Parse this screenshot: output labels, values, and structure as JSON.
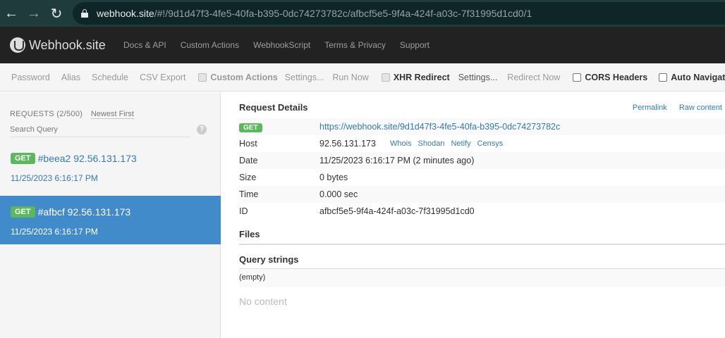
{
  "browser": {
    "url_host": "webhook.site",
    "url_path": "/#!/9d1d47f3-4fe5-40fa-b395-0dc74273782c/afbcf5e5-9f4a-424f-a03c-7f31995d1cd0/1"
  },
  "navbar": {
    "brand": "Webhook.site",
    "links": [
      "Docs & API",
      "Custom Actions",
      "WebhookScript",
      "Terms & Privacy",
      "Support"
    ]
  },
  "toolbar": {
    "password": "Password",
    "alias": "Alias",
    "schedule": "Schedule",
    "csv_export": "CSV Export",
    "custom_actions": "Custom Actions",
    "custom_settings": "Settings...",
    "run_now": "Run Now",
    "xhr_redirect": "XHR Redirect",
    "xhr_settings": "Settings...",
    "redirect_now": "Redirect Now",
    "cors_headers": "CORS Headers",
    "auto_navigate": "Auto Navigate"
  },
  "sidebar": {
    "requests_count": "REQUESTS (2/500)",
    "sort": "Newest First",
    "search_placeholder": "Search Query",
    "help": "?",
    "items": [
      {
        "method": "GET",
        "title": "#beea2 92.56.131.173",
        "time": "11/25/2023 6:16:17 PM",
        "selected": false
      },
      {
        "method": "GET",
        "title": "#afbcf 92.56.131.173",
        "time": "11/25/2023 6:16:17 PM",
        "selected": true
      }
    ]
  },
  "details": {
    "title": "Request Details",
    "permalink": "Permalink",
    "raw_content": "Raw content",
    "method": "GET",
    "url": "https://webhook.site/9d1d47f3-4fe5-40fa-b395-0dc74273782c",
    "rows": {
      "host_label": "Host",
      "host": "92.56.131.173",
      "date_label": "Date",
      "date": "11/25/2023 6:16:17 PM (2 minutes ago)",
      "size_label": "Size",
      "size": "0 bytes",
      "time_label": "Time",
      "time": "0.000 sec",
      "id_label": "ID",
      "id": "afbcf5e5-9f4a-424f-a03c-7f31995d1cd0"
    },
    "lookups": [
      "Whois",
      "Shodan",
      "Netify",
      "Censys"
    ]
  },
  "files": {
    "title": "Files"
  },
  "query_strings": {
    "title": "Query strings",
    "empty": "(empty)"
  },
  "content": {
    "empty": "No content"
  }
}
